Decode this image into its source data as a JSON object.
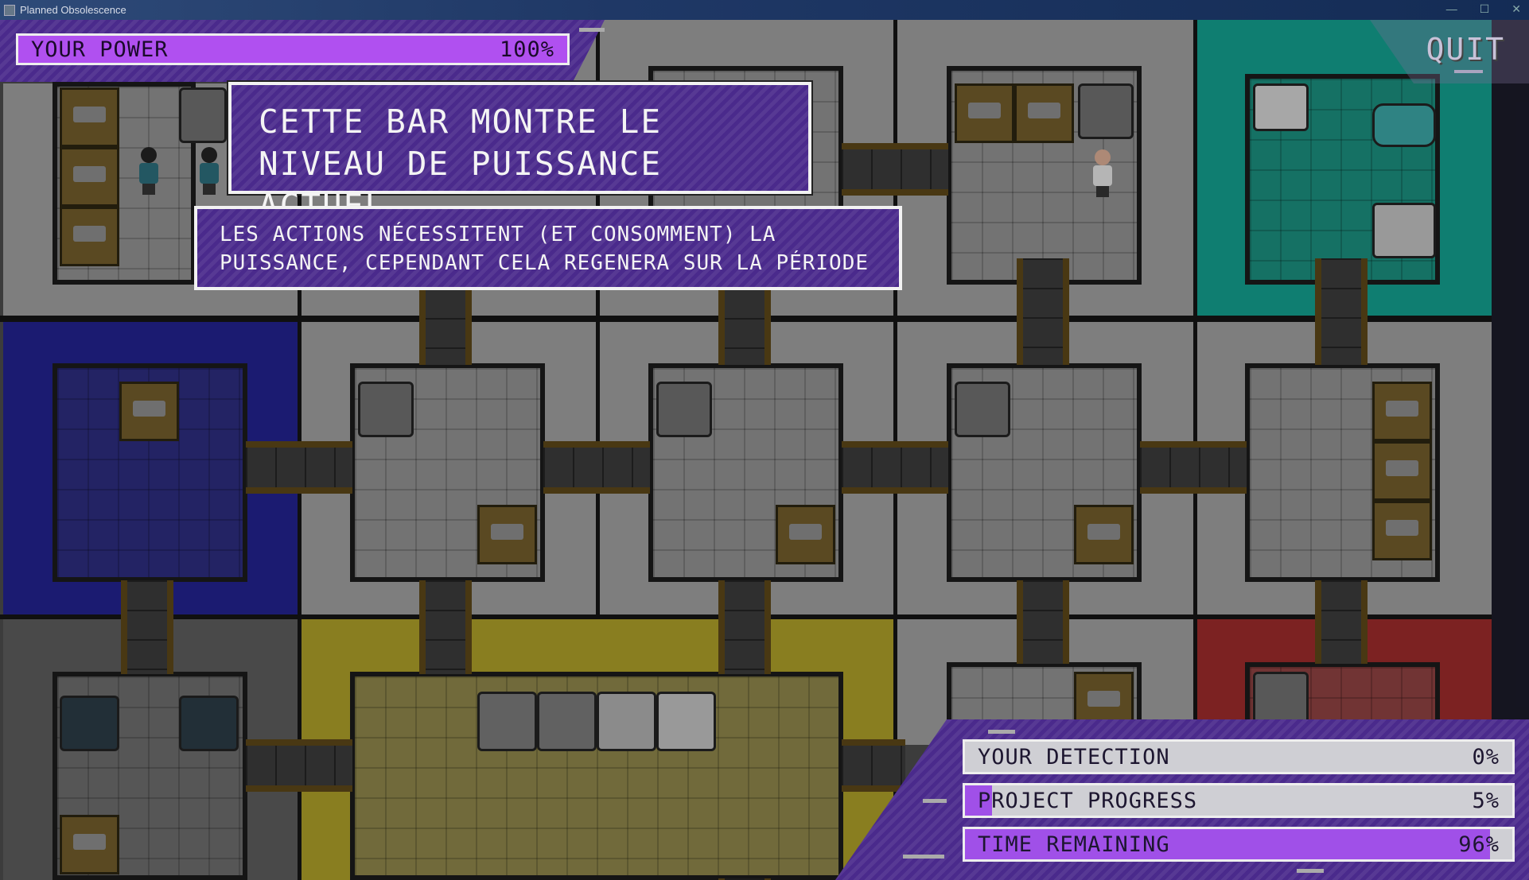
{
  "window": {
    "title": "Planned Obsolescence"
  },
  "hud": {
    "power": {
      "label": "YOUR POWER",
      "value_text": "100%",
      "level": 1.0
    },
    "quit_label": "QUIT",
    "stats": [
      {
        "label": "YOUR DETECTION",
        "value_text": "0%",
        "level": 0.0
      },
      {
        "label": "PROJECT PROGRESS",
        "value_text": "5%",
        "level": 0.05
      },
      {
        "label": "TIME REMAINING",
        "value_text": "96%",
        "level": 0.96
      }
    ]
  },
  "tutorial": {
    "title_line1": "CETTE BAR MONTRE LE",
    "title_line2": "NIVEAU DE PUISSANCE ACTUEL",
    "body_line1": "LES ACTIONS NÉCESSITENT (ET CONSOMMENT) LA",
    "body_line2": "PUISSANCE, CEPENDANT CELA REGENERA SUR LA PÉRIODE"
  },
  "colors": {
    "hud_purple": "#4a2a8c",
    "power_fill": "#b050f0",
    "stat_fill": "#a050e8",
    "room_teal": "#1aa898",
    "room_blue": "#2a2aa0",
    "room_yellow": "#b8a830",
    "room_red": "#a83838"
  }
}
